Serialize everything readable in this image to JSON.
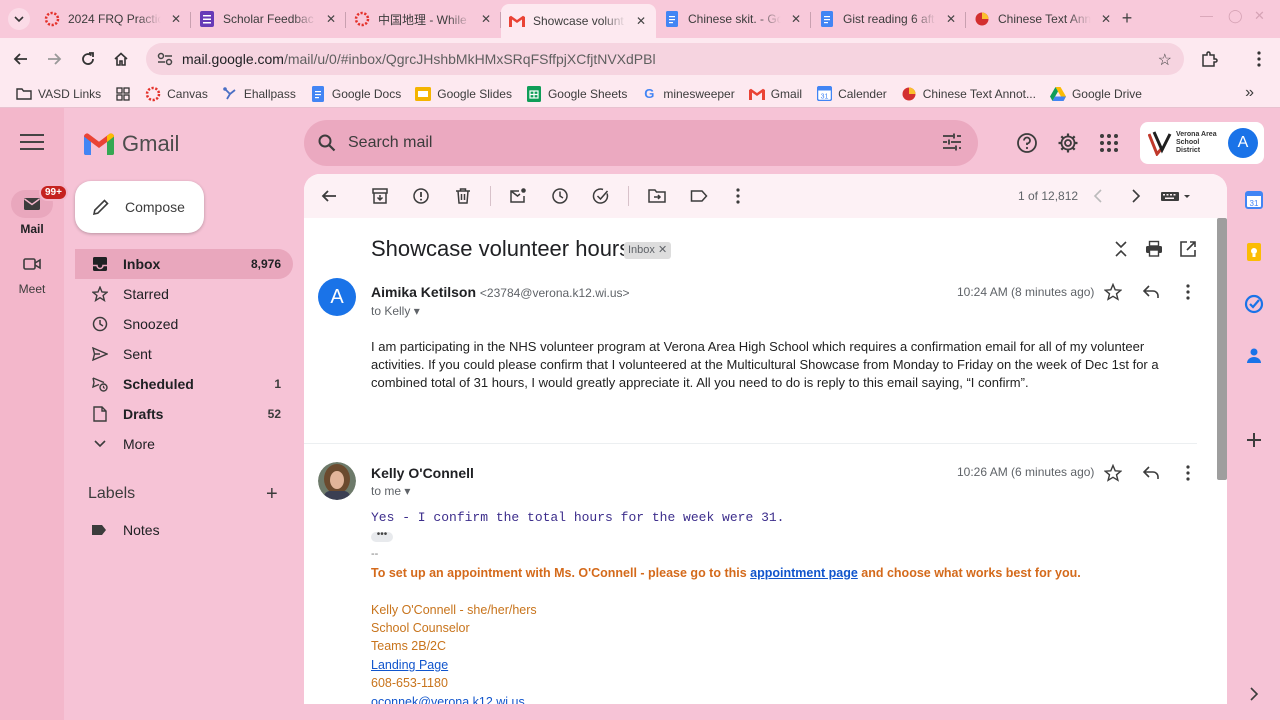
{
  "browser": {
    "tabs": [
      {
        "title": "2024 FRQ Practic",
        "icon": "canvas-icon",
        "active": false
      },
      {
        "title": "Scholar Feedbac",
        "icon": "forms-icon",
        "active": false
      },
      {
        "title": "中国地理 - While I",
        "icon": "canvas-icon",
        "active": false
      },
      {
        "title": "Showcase volunt",
        "icon": "gmail-icon",
        "active": true
      },
      {
        "title": "Chinese skit. - Go",
        "icon": "docs-icon",
        "active": false
      },
      {
        "title": "Gist reading 6 aft",
        "icon": "docs-icon",
        "active": false
      },
      {
        "title": "Chinese Text Ann",
        "icon": "chinese-annotator-icon",
        "active": false
      }
    ],
    "url_host": "mail.google.com",
    "url_path": "/mail/u/0/#inbox/QgrcJHshbMkHMxSRqFSffpjXCfjtNVXdPBl",
    "bookmarks": [
      {
        "label": "VASD Links",
        "icon": "folder-icon"
      },
      {
        "label": "",
        "icon": "apps-grid-icon"
      },
      {
        "label": "Canvas",
        "icon": "canvas-icon"
      },
      {
        "label": "Ehallpass",
        "icon": "ehallpass-icon"
      },
      {
        "label": "Google Docs",
        "icon": "docs-icon"
      },
      {
        "label": "Google Slides",
        "icon": "slides-icon"
      },
      {
        "label": "Google Sheets",
        "icon": "sheets-icon"
      },
      {
        "label": "minesweeper",
        "icon": "google-icon"
      },
      {
        "label": "Gmail",
        "icon": "gmail-icon"
      },
      {
        "label": "Calender",
        "icon": "calendar-icon"
      },
      {
        "label": "Chinese Text Annot...",
        "icon": "chinese-annotator-icon"
      },
      {
        "label": "Google Drive",
        "icon": "drive-icon"
      }
    ]
  },
  "gmail": {
    "logo_text": "Gmail",
    "rail": {
      "mail_label": "Mail",
      "mail_badge": "99+",
      "meet_label": "Meet"
    },
    "search_placeholder": "Search mail",
    "account_initial": "A",
    "district_name": "Verona Area School District",
    "compose_label": "Compose",
    "nav": [
      {
        "label": "Inbox",
        "count": "8,976",
        "icon": "inbox-icon",
        "active": true,
        "bold": true
      },
      {
        "label": "Starred",
        "count": "",
        "icon": "star-icon",
        "active": false,
        "bold": false
      },
      {
        "label": "Snoozed",
        "count": "",
        "icon": "clock-icon",
        "active": false,
        "bold": false
      },
      {
        "label": "Sent",
        "count": "",
        "icon": "send-icon",
        "active": false,
        "bold": false
      },
      {
        "label": "Scheduled",
        "count": "1",
        "icon": "scheduled-send-icon",
        "active": false,
        "bold": true
      },
      {
        "label": "Drafts",
        "count": "52",
        "icon": "draft-icon",
        "active": false,
        "bold": true
      },
      {
        "label": "More",
        "count": "",
        "icon": "chevron-down-icon",
        "active": false,
        "bold": false
      }
    ],
    "labels_heading": "Labels",
    "labels": [
      {
        "label": "Notes",
        "icon": "label-icon"
      }
    ],
    "pagination": "1 of 12,812",
    "thread": {
      "subject": "Showcase volunteer hours",
      "chip": "Inbox",
      "messages": [
        {
          "avatar_initial": "A",
          "sender": "Aimika Ketilson",
          "email": "<23784@verona.k12.wi.us>",
          "to": "to Kelly",
          "time": "10:24 AM (8 minutes ago)",
          "body": "I am participating in the NHS volunteer program at Verona Area High School which requires a confirmation email for all of my volunteer activities. If you could please confirm that I volunteered at the Multicultural Showcase from Monday to Friday on the week of Dec 1st  for a combined total of 31 hours, I would greatly appreciate it. All you need to do is reply to this email saying, “I confirm”."
        },
        {
          "sender": "Kelly O'Connell",
          "to": "to me",
          "time": "10:26 AM (6 minutes ago)",
          "body": "Yes - I confirm the total hours for the week were 31.",
          "sig_dash": "--",
          "cta_before": "To set up an appointment with Ms. O'Connell - please go to this ",
          "cta_link": "appointment page",
          "cta_after": " and choose what works best for you.",
          "signature": {
            "name": "Kelly O'Connell - she/her/hers",
            "role": "School Counselor",
            "teams": "Teams 2B/2C",
            "landing": "Landing Page",
            "phone": "608-653-1180",
            "email": "oconnek@verona.k12.wi.us"
          }
        }
      ]
    }
  }
}
